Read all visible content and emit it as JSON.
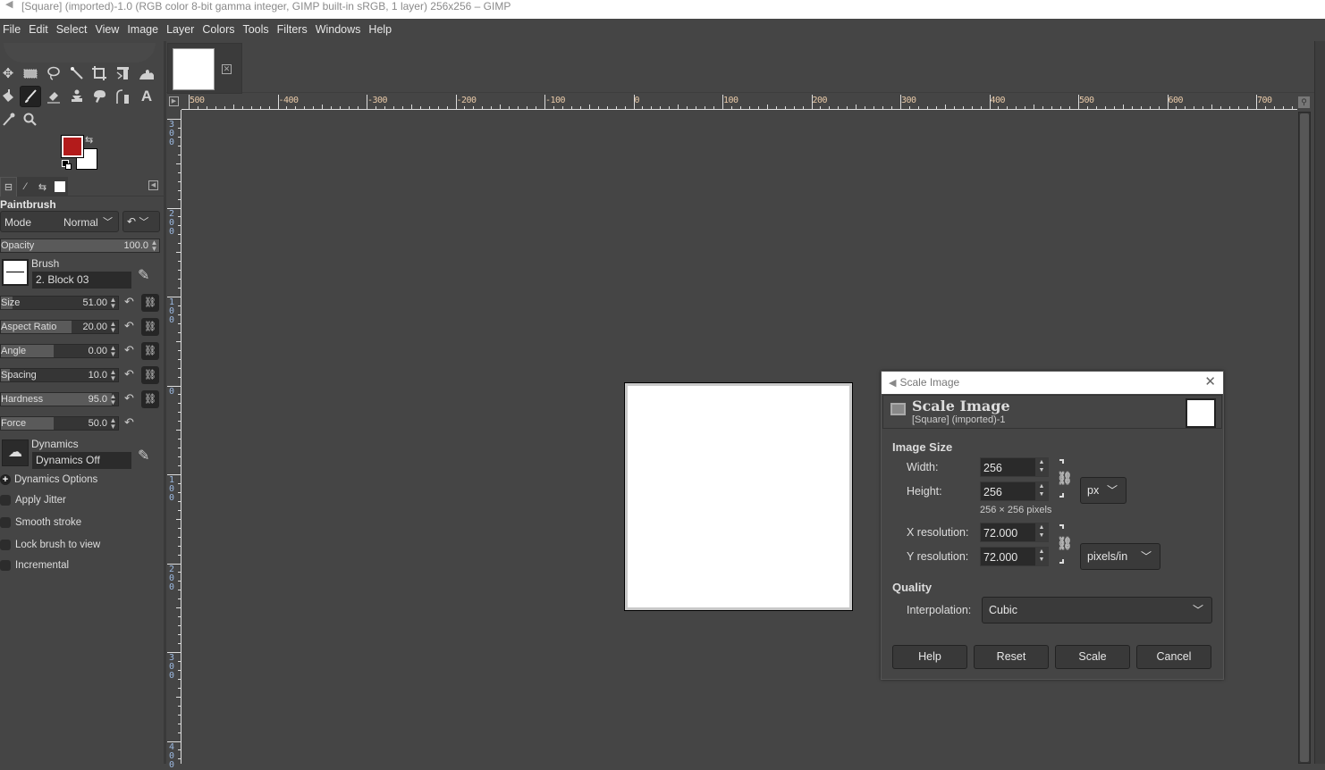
{
  "window": {
    "title": "[Square] (imported)-1.0 (RGB color 8-bit gamma integer, GIMP built-in sRGB, 1 layer) 256x256 – GIMP"
  },
  "menu": [
    "File",
    "Edit",
    "Select",
    "View",
    "Image",
    "Layer",
    "Colors",
    "Tools",
    "Filters",
    "Windows",
    "Help"
  ],
  "toolbox": {
    "tools": [
      {
        "name": "move-tool",
        "glyph": "✥"
      },
      {
        "name": "rect-select-tool",
        "glyph": "▭"
      },
      {
        "name": "free-select-tool",
        "glyph": "ꝏ"
      },
      {
        "name": "fuzzy-select-tool",
        "glyph": "⟋"
      },
      {
        "name": "crop-tool",
        "glyph": "⌗"
      },
      {
        "name": "transform-tool",
        "glyph": "⊤"
      },
      {
        "name": "warp-tool",
        "glyph": "◒"
      },
      {
        "name": "bucket-fill-tool",
        "glyph": "⛀"
      },
      {
        "name": "paintbrush-tool",
        "glyph": "⁄",
        "active": true
      },
      {
        "name": "eraser-tool",
        "glyph": "◆"
      },
      {
        "name": "clone-tool",
        "glyph": "⚲"
      },
      {
        "name": "smudge-tool",
        "glyph": "☚"
      },
      {
        "name": "paths-tool",
        "glyph": "⌒"
      },
      {
        "name": "text-tool",
        "glyph": "A"
      },
      {
        "name": "color-picker-tool",
        "glyph": "⟋"
      },
      {
        "name": "zoom-tool",
        "glyph": "⚲"
      }
    ],
    "fg_color": "#b31b1b",
    "bg_color": "#ffffff"
  },
  "tool_options": {
    "title": "Paintbrush",
    "mode_label": "Mode",
    "mode_value": "Normal",
    "opacity": {
      "label": "Opacity",
      "value": "100.0",
      "fraction": 1.0
    },
    "brush_label": "Brush",
    "brush_name": "2. Block 03",
    "sliders": [
      {
        "label": "Size",
        "value": "51.00",
        "fraction": 0.1,
        "chain": true
      },
      {
        "label": "Aspect Ratio",
        "value": "20.00",
        "fraction": 0.6,
        "chain": true
      },
      {
        "label": "Angle",
        "value": "0.00",
        "fraction": 0.45,
        "chain": true
      },
      {
        "label": "Spacing",
        "value": "10.0",
        "fraction": 0.08,
        "chain": true
      },
      {
        "label": "Hardness",
        "value": "95.0",
        "fraction": 0.95,
        "chain": true
      },
      {
        "label": "Force",
        "value": "50.0",
        "fraction": 0.45,
        "chain": false
      }
    ],
    "dynamics_label": "Dynamics",
    "dynamics_name": "Dynamics Off",
    "dynamics_options": "Dynamics Options",
    "checkboxes": [
      {
        "label": "Apply Jitter",
        "checked": false
      },
      {
        "label": "Smooth stroke",
        "checked": false
      },
      {
        "label": "Lock brush to view",
        "checked": false
      },
      {
        "label": "Incremental",
        "checked": false
      }
    ]
  },
  "rulers": {
    "horizontal": [
      "500",
      "-400",
      "-300",
      "-200",
      "-100",
      "0",
      "100",
      "200",
      "300",
      "400",
      "500",
      "600",
      "700"
    ],
    "vertical": [
      "300",
      "200",
      "100",
      "0",
      "100",
      "200",
      "300",
      "400"
    ]
  },
  "dialog": {
    "window_title": "Scale Image",
    "header_title": "Scale Image",
    "header_subtitle": "[Square] (imported)-1",
    "image_size_label": "Image Size",
    "width_label": "Width:",
    "width_value": "256",
    "height_label": "Height:",
    "height_value": "256",
    "size_unit": "px",
    "size_note": "256 × 256 pixels",
    "xres_label": "X resolution:",
    "xres_value": "72.000",
    "yres_label": "Y resolution:",
    "yres_value": "72.000",
    "res_unit": "pixels/in",
    "quality_label": "Quality",
    "interp_label": "Interpolation:",
    "interp_value": "Cubic",
    "buttons": {
      "help": "Help",
      "reset": "Reset",
      "scale": "Scale",
      "cancel": "Cancel"
    }
  }
}
